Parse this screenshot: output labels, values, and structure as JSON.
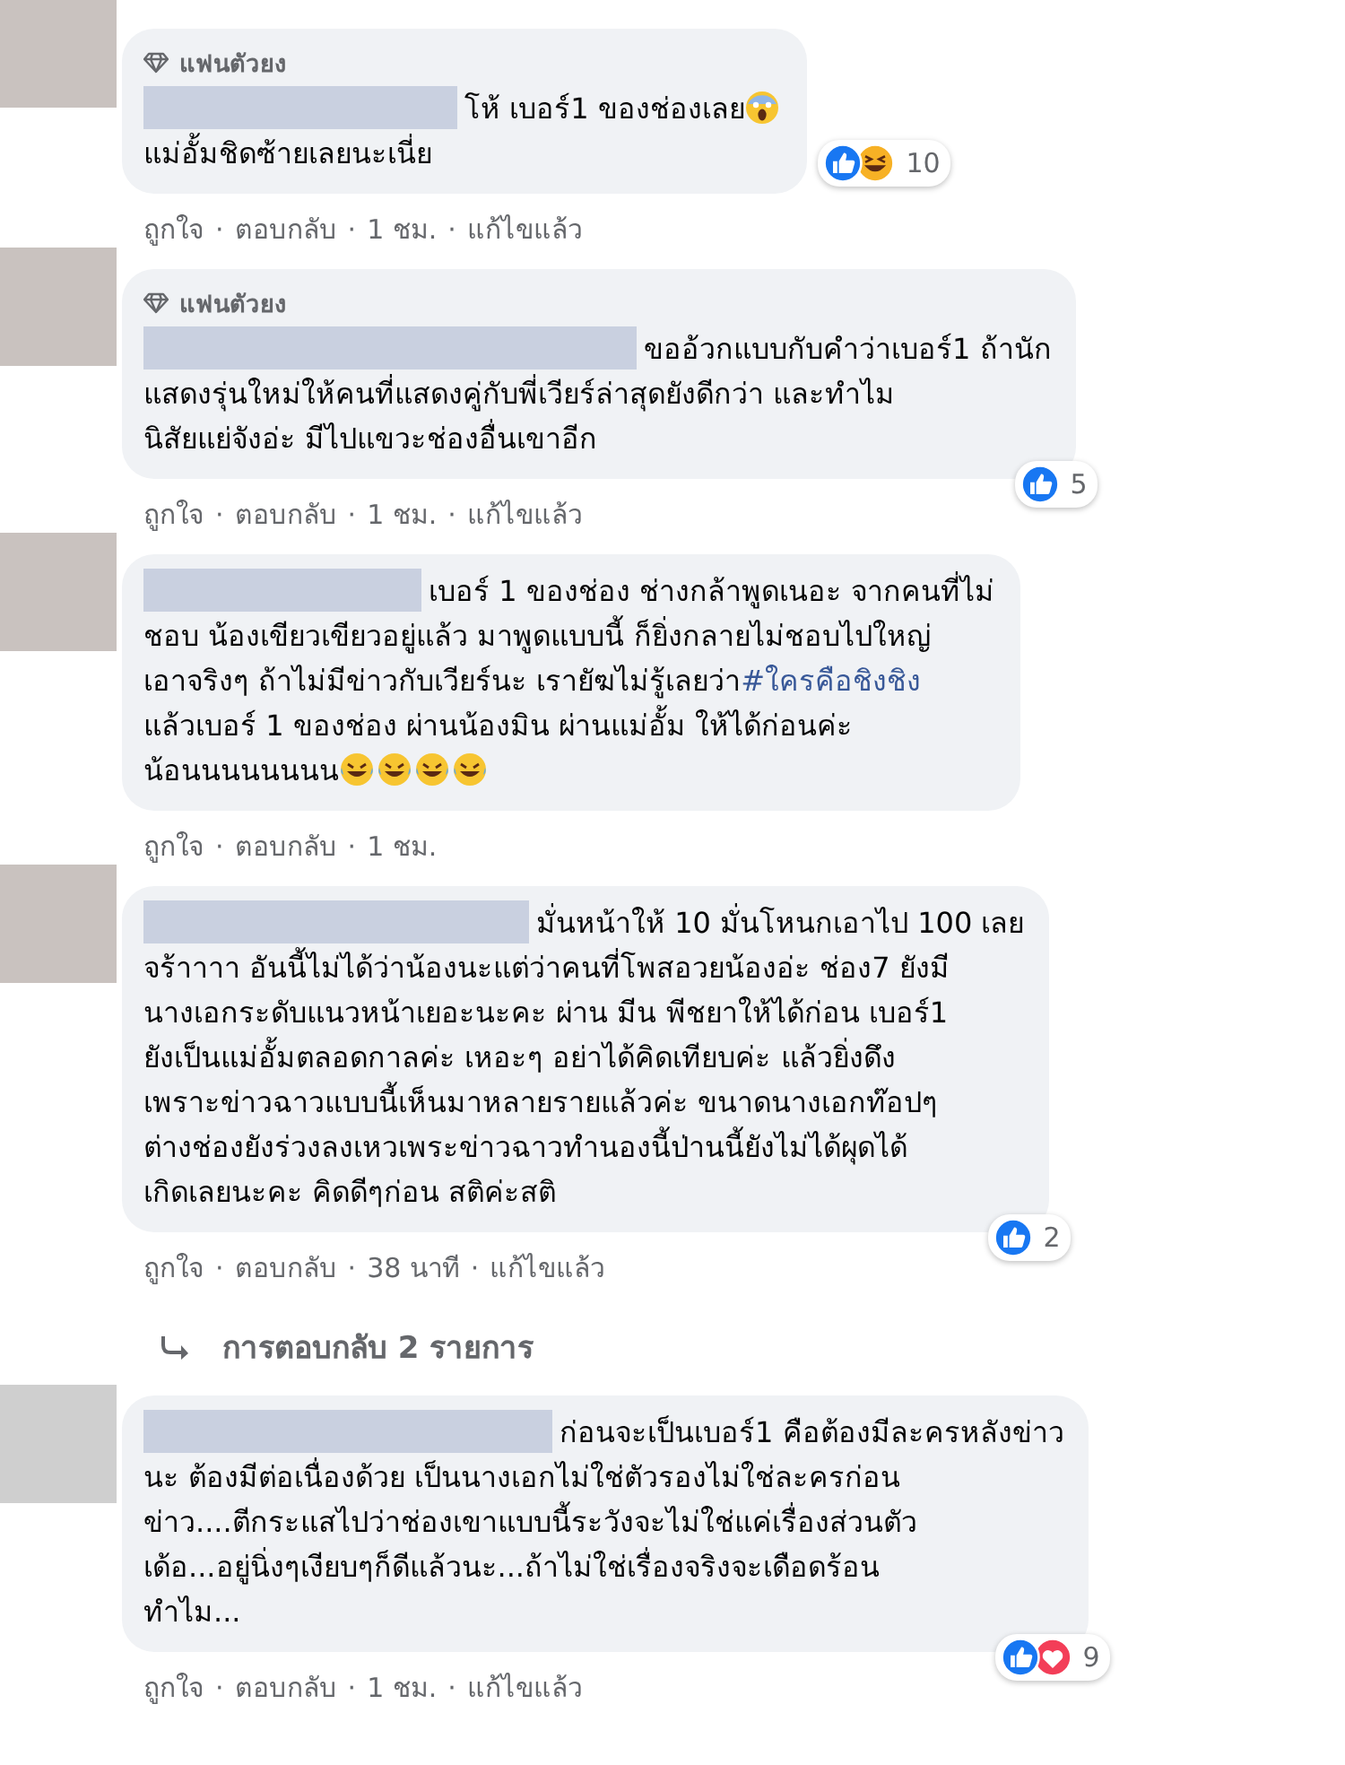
{
  "separator": "·",
  "comments": [
    {
      "badge": "แฟนตัวยง",
      "lines": [
        {
          "text": "โห้ เบอร์1 ของช่องเลย",
          "emojis": [
            {
              "kind": "scream"
            }
          ]
        },
        {
          "text": "แม่อั้มชิดซ้ายเลยนะเนี่ย"
        }
      ],
      "reactions": [
        {
          "kind": "like"
        },
        {
          "kind": "haha"
        }
      ],
      "reaction_count": "10",
      "actions": [
        "ถูกใจ",
        "ตอบกลับ"
      ],
      "time": "1 ชม.",
      "edited": "แก้ไขแล้ว"
    },
    {
      "badge": "แฟนตัวยง",
      "lines": [
        {
          "text": "ขออ้วกแบบกับคำว่าเบอร์1 ถ้านัก"
        },
        {
          "text": "แสดงรุ่นใหม่ให้คนที่แสดงคู่กับพี่เวียร์ล่าสุดยังดีกว่า และทำไม"
        },
        {
          "text": "นิสัยแย่จังอ่ะ มีไปแขวะช่องอื่นเขาอีก"
        }
      ],
      "reactions": [
        {
          "kind": "like"
        }
      ],
      "reaction_count": "5",
      "actions": [
        "ถูกใจ",
        "ตอบกลับ"
      ],
      "time": "1 ชม.",
      "edited": "แก้ไขแล้ว"
    },
    {
      "lines": [
        {
          "text": "เบอร์ 1 ของช่อง ช่างกล้าพูดเนอะ จากคนที่ไม่"
        },
        {
          "text": "ชอบ น้องเขียวเขียวอยู่แล้ว มาพูดแบบนี้ ก็ยิ่งกลายไม่ชอบไปใหญ่"
        },
        {
          "text": "เอาจริงๆ ถ้าไม่มีข่าวกับเวียร์นะ เรายัฆไม่รู้เลยว่า",
          "hashtag": "#ใครคือชิงชิง"
        },
        {
          "text": "แล้วเบอร์ 1 ของช่อง ผ่านน้องมิน ผ่านแม่อั้ม ให้ได้ก่อนค่ะ"
        },
        {
          "text": "น้อนนนนนนนน",
          "emojis": [
            {
              "kind": "rofl"
            },
            {
              "kind": "rofl"
            },
            {
              "kind": "rofl"
            },
            {
              "kind": "rofl"
            }
          ]
        }
      ],
      "actions": [
        "ถูกใจ",
        "ตอบกลับ"
      ],
      "time": "1 ชม."
    },
    {
      "lines": [
        {
          "text": "มั่นหน้าให้ 10 มั่นโหนกเอาไป 100 เลย"
        },
        {
          "text": "จร้าาาา อันนี้ไม่ได้ว่าน้องนะแต่ว่าคนที่โพสอวยน้องอ่ะ ช่อง7 ยังมี"
        },
        {
          "text": "นางเอกระดับแนวหน้าเยอะนะคะ ผ่าน มีน พีชยาให้ได้ก่อน เบอร์1"
        },
        {
          "text": "ยังเป็นแม่อั้มตลอดกาลค่ะ เหอะๆ อย่าได้คิดเทียบค่ะ แล้วยิ่งดึง"
        },
        {
          "text": "เพราะข่าวฉาวแบบนี้เห็นมาหลายรายแล้วค่ะ ขนาดนางเอกท๊อปๆ"
        },
        {
          "text": "ต่างช่องยังร่วงลงเหวเพระข่าวฉาวทำนองนี้ป่านนี้ยังไม่ได้ผุดได้"
        },
        {
          "text": "เกิดเลยนะคะ คิดดีๆก่อน สติค่ะสติ"
        }
      ],
      "reactions": [
        {
          "kind": "like"
        }
      ],
      "reaction_count": "2",
      "actions": [
        "ถูกใจ",
        "ตอบกลับ"
      ],
      "time": "38 นาที",
      "edited": "แก้ไขแล้ว",
      "replies_link": "การตอบกลับ 2 รายการ"
    },
    {
      "lines": [
        {
          "text": "ก่อนจะเป็นเบอร์1 คือต้องมีละครหลังข่าว"
        },
        {
          "text": "นะ ต้องมีต่อเนื่องด้วย เป็นนางเอกไม่ใช่ตัวรองไม่ใช่ละครก่อน"
        },
        {
          "text": "ข่าว....ตีกระแสไปว่าช่องเขาแบบนี้ระวังจะไม่ใช่แค่เรื่องส่วนตัว"
        },
        {
          "text": "เด้อ...อยู่นิ่งๆเงียบๆก็ดีแล้วนะ...ถ้าไม่ใช่เรื่องจริงจะเดือดร้อน"
        },
        {
          "text": "ทำไม..."
        }
      ],
      "reactions": [
        {
          "kind": "like"
        },
        {
          "kind": "love"
        }
      ],
      "reaction_count": "9",
      "actions": [
        "ถูกใจ",
        "ตอบกลับ"
      ],
      "time": "1 ชม.",
      "edited": "แก้ไขแล้ว"
    }
  ]
}
